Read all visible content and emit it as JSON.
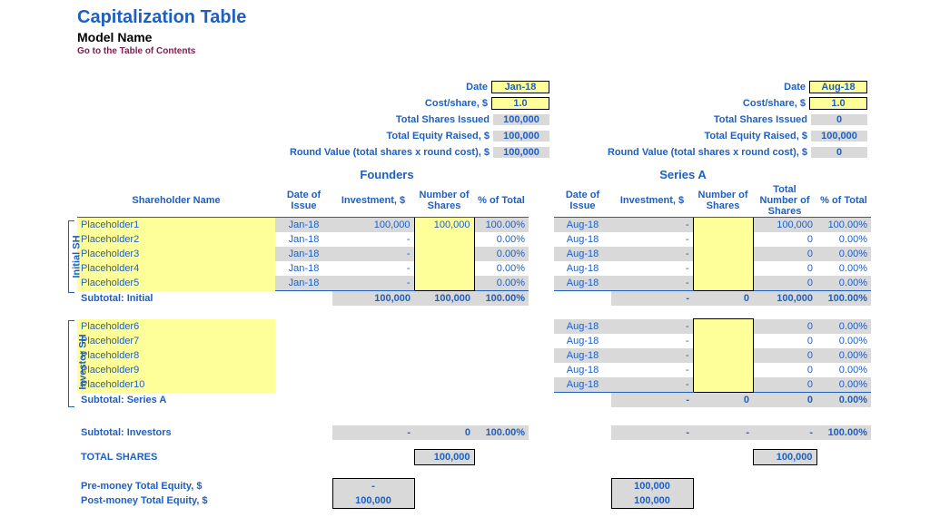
{
  "header": {
    "title": "Capitalization Table",
    "subtitle": "Model Name",
    "toc": "Go to the Table of Contents"
  },
  "summary": {
    "labels": {
      "date": "Date",
      "cost": "Cost/share, $",
      "shares": "Total Shares Issued",
      "equity": "Total Equity Raised, $",
      "round": "Round Value (total shares x round cost), $"
    },
    "founders": {
      "date": "Jan-18",
      "cost": "1.0",
      "shares": "100,000",
      "equity": "100,000",
      "round": "100,000"
    },
    "seriesA": {
      "date": "Aug-18",
      "cost": "1.0",
      "shares": "0",
      "equity": "100,000",
      "round": "0"
    }
  },
  "sections": {
    "founders": "Founders",
    "seriesA": "Series A"
  },
  "columns": {
    "shareholder": "Shareholder Name",
    "dateIssue": "Date of Issue",
    "investment": "Investment, $",
    "numShares": "Number of Shares",
    "totShares": "Total Number of Shares",
    "pctTotal": "% of Total"
  },
  "groups": {
    "initial": "Initial SH",
    "investor": "Investor SH"
  },
  "initial": [
    {
      "name": "Placeholder1",
      "f_date": "Jan-18",
      "f_inv": "100,000",
      "f_sh": "100,000",
      "f_pct": "100.00%",
      "a_date": "Aug-18",
      "a_inv": "-",
      "a_sh": "",
      "a_tot": "100,000",
      "a_pct": "100.00%"
    },
    {
      "name": "Placeholder2",
      "f_date": "Jan-18",
      "f_inv": "-",
      "f_sh": "",
      "f_pct": "0.00%",
      "a_date": "Aug-18",
      "a_inv": "-",
      "a_sh": "",
      "a_tot": "0",
      "a_pct": "0.00%"
    },
    {
      "name": "Placeholder3",
      "f_date": "Jan-18",
      "f_inv": "-",
      "f_sh": "",
      "f_pct": "0.00%",
      "a_date": "Aug-18",
      "a_inv": "-",
      "a_sh": "",
      "a_tot": "0",
      "a_pct": "0.00%"
    },
    {
      "name": "Placeholder4",
      "f_date": "Jan-18",
      "f_inv": "-",
      "f_sh": "",
      "f_pct": "0.00%",
      "a_date": "Aug-18",
      "a_inv": "-",
      "a_sh": "",
      "a_tot": "0",
      "a_pct": "0.00%"
    },
    {
      "name": "Placeholder5",
      "f_date": "Jan-18",
      "f_inv": "-",
      "f_sh": "",
      "f_pct": "0.00%",
      "a_date": "Aug-18",
      "a_inv": "-",
      "a_sh": "",
      "a_tot": "0",
      "a_pct": "0.00%"
    }
  ],
  "subtotalInitial": {
    "label": "Subtotal: Initial",
    "f_inv": "100,000",
    "f_sh": "100,000",
    "f_pct": "100.00%",
    "a_inv": "-",
    "a_sh": "0",
    "a_tot": "100,000",
    "a_pct": "100.00%"
  },
  "investor": [
    {
      "name": "Placeholder6",
      "a_date": "Aug-18",
      "a_inv": "-",
      "a_sh": "",
      "a_tot": "0",
      "a_pct": "0.00%"
    },
    {
      "name": "Placeholder7",
      "a_date": "Aug-18",
      "a_inv": "-",
      "a_sh": "",
      "a_tot": "0",
      "a_pct": "0.00%"
    },
    {
      "name": "Placeholder8",
      "a_date": "Aug-18",
      "a_inv": "-",
      "a_sh": "",
      "a_tot": "0",
      "a_pct": "0.00%"
    },
    {
      "name": "Placeholder9",
      "a_date": "Aug-18",
      "a_inv": "-",
      "a_sh": "",
      "a_tot": "0",
      "a_pct": "0.00%"
    },
    {
      "name": "Placeholder10",
      "a_date": "Aug-18",
      "a_inv": "-",
      "a_sh": "",
      "a_tot": "0",
      "a_pct": "0.00%"
    }
  ],
  "subtotalSeriesA": {
    "label": "Subtotal: Series A",
    "a_inv": "-",
    "a_sh": "0",
    "a_tot": "0",
    "a_pct": "0.00%"
  },
  "subtotalInvestors": {
    "label": "Subtotal: Investors",
    "f_inv": "-",
    "f_sh": "0",
    "f_pct": "100.00%",
    "a_inv": "-",
    "a_sh": "-",
    "a_tot": "-",
    "a_pct": "100.00%"
  },
  "totals": {
    "sharesLabel": "TOTAL SHARES",
    "fShares": "100,000",
    "aShares": "100,000",
    "preLabel": "Pre-money Total Equity, $",
    "postLabel": "Post-money Total Equity, $",
    "fPre": "-",
    "fPost": "100,000",
    "aPre": "100,000",
    "aPost": "100,000"
  }
}
